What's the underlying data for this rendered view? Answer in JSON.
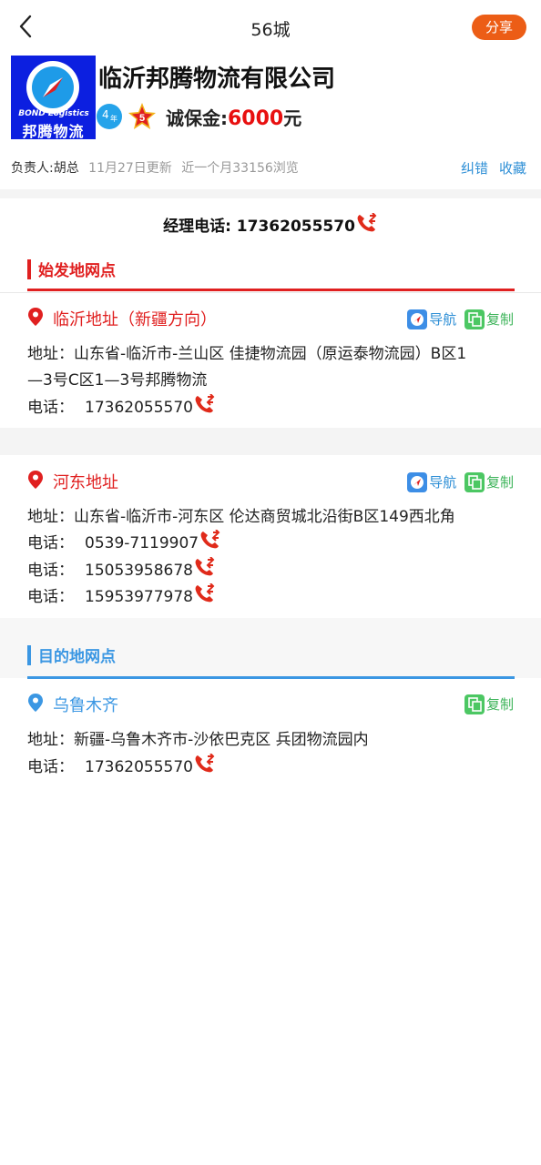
{
  "nav": {
    "title": "56城",
    "share_label": "分享"
  },
  "company": {
    "logo_en": "BOND Logistics",
    "logo_cn": "邦腾物流",
    "name": "临沂邦腾物流有限公司",
    "years": "4",
    "years_unit": "年",
    "star_level": "5",
    "deposit_label": "诚保金:",
    "deposit_amount": "6000",
    "deposit_unit": "元",
    "owner": "负责人:胡总",
    "updated": "11月27日更新",
    "views": "近一个月33156浏览",
    "correct_label": "纠错",
    "favorite_label": "收藏"
  },
  "manager_phone": "经理电话: 17362055570",
  "origin": {
    "heading": "始发地网点",
    "color": "#e02020",
    "addresses": [
      {
        "title": "临沂地址（新疆方向）",
        "nav_label": "导航",
        "copy_label": "复制",
        "address_line1": "地址：山东省-临沂市-兰山区 佳捷物流园（原运泰物流园）B区1",
        "address_line2": "—3号C区1—3号邦腾物流",
        "phone_label": "电话：",
        "phones": [
          "17362055570"
        ]
      },
      {
        "title": "河东地址",
        "nav_label": "导航",
        "copy_label": "复制",
        "address_line1": "地址：山东省-临沂市-河东区 伦达商贸城北沿街B区149西北角",
        "phone_label": "电话：",
        "phones": [
          "0539-7119907",
          "15053958678",
          "15953977978"
        ]
      }
    ]
  },
  "destination": {
    "heading": "目的地网点",
    "color": "#3b97e3",
    "addresses": [
      {
        "title": "乌鲁木齐",
        "copy_label": "复制",
        "address_line1": "地址：新疆-乌鲁木齐市-沙依巴克区 兵团物流园内",
        "phone_label": "电话：",
        "phones": [
          "17362055570"
        ]
      }
    ]
  },
  "icons": {
    "back": "back-arrow-icon",
    "phone": "phone-call-icon",
    "pin": "location-pin-icon",
    "nav": "navigation-icon",
    "copy": "copy-icon"
  },
  "colors": {
    "accent": "#ec5d16",
    "phone_icon": "#e02a1a",
    "link": "#2e8fd6",
    "copy_green": "#3db45a"
  }
}
